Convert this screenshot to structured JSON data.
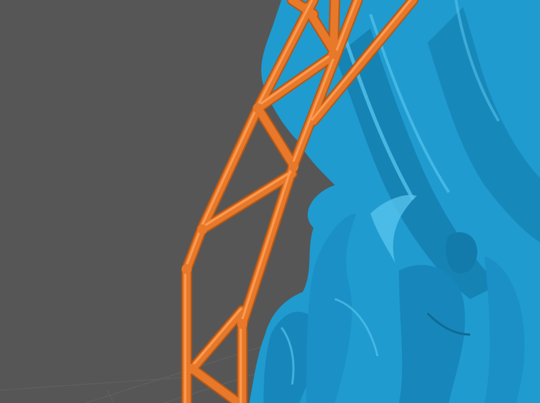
{
  "viewport": {
    "background_color": "#565656",
    "floor_grid_color": "#6a6a6a"
  },
  "model": {
    "color": "#1f9bd0",
    "shade_color": "#137bab",
    "highlight_color": "#56c3ec"
  },
  "supports": {
    "color": "#e8782a",
    "shade_color": "#b65714",
    "highlight_color": "#ffa35a"
  }
}
